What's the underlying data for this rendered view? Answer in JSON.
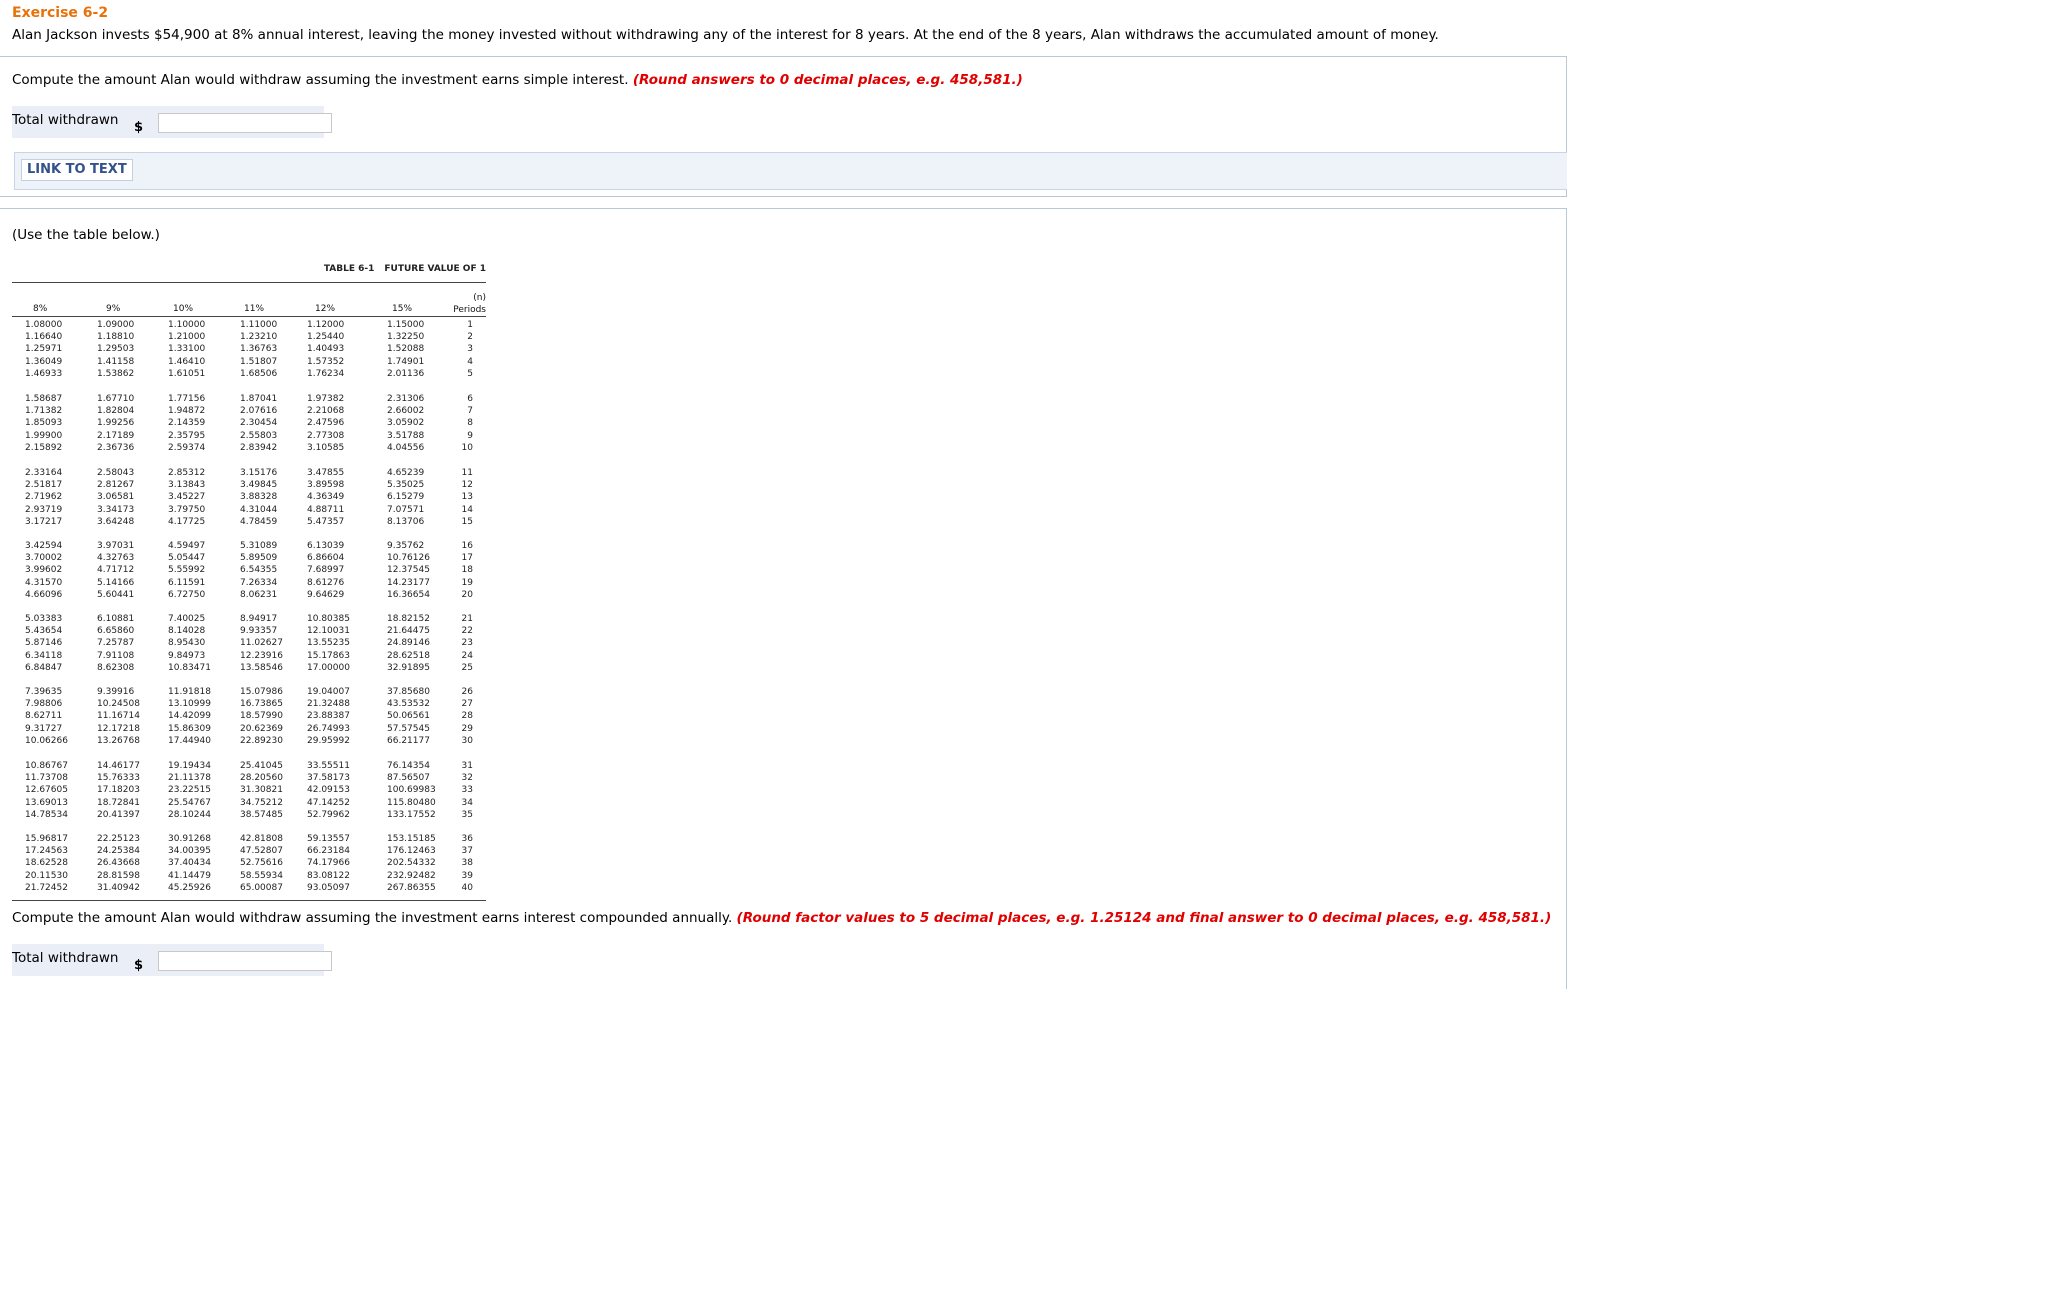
{
  "exercise_title": "Exercise 6-2",
  "problem_text": "Alan Jackson invests $54,900 at 8% annual interest, leaving the money invested without withdrawing any of the interest for 8 years. At the end of the 8 years, Alan withdraws the accumulated amount of money.",
  "q1": {
    "prompt": "Compute the amount Alan would withdraw assuming the investment earns simple interest.",
    "instruction": "(Round answers to 0 decimal places, e.g. 458,581.)",
    "answer_label": "Total withdrawn",
    "currency": "$",
    "value": ""
  },
  "link_button": "LINK TO TEXT",
  "use_table": "(Use the table below.)",
  "table": {
    "title_prefix": "TABLE 6-1",
    "title": "FUTURE VALUE OF 1",
    "headers": [
      "8%",
      "9%",
      "10%",
      "11%",
      "12%",
      "15%"
    ],
    "periods_header_top": "(n)",
    "periods_header": "Periods",
    "groups": [
      [
        [
          "1.08000",
          "1.09000",
          "1.10000",
          "1.11000",
          "1.12000",
          "1.15000",
          "1"
        ],
        [
          "1.16640",
          "1.18810",
          "1.21000",
          "1.23210",
          "1.25440",
          "1.32250",
          "2"
        ],
        [
          "1.25971",
          "1.29503",
          "1.33100",
          "1.36763",
          "1.40493",
          "1.52088",
          "3"
        ],
        [
          "1.36049",
          "1.41158",
          "1.46410",
          "1.51807",
          "1.57352",
          "1.74901",
          "4"
        ],
        [
          "1.46933",
          "1.53862",
          "1.61051",
          "1.68506",
          "1.76234",
          "2.01136",
          "5"
        ]
      ],
      [
        [
          "1.58687",
          "1.67710",
          "1.77156",
          "1.87041",
          "1.97382",
          "2.31306",
          "6"
        ],
        [
          "1.71382",
          "1.82804",
          "1.94872",
          "2.07616",
          "2.21068",
          "2.66002",
          "7"
        ],
        [
          "1.85093",
          "1.99256",
          "2.14359",
          "2.30454",
          "2.47596",
          "3.05902",
          "8"
        ],
        [
          "1.99900",
          "2.17189",
          "2.35795",
          "2.55803",
          "2.77308",
          "3.51788",
          "9"
        ],
        [
          "2.15892",
          "2.36736",
          "2.59374",
          "2.83942",
          "3.10585",
          "4.04556",
          "10"
        ]
      ],
      [
        [
          "2.33164",
          "2.58043",
          "2.85312",
          "3.15176",
          "3.47855",
          "4.65239",
          "11"
        ],
        [
          "2.51817",
          "2.81267",
          "3.13843",
          "3.49845",
          "3.89598",
          "5.35025",
          "12"
        ],
        [
          "2.71962",
          "3.06581",
          "3.45227",
          "3.88328",
          "4.36349",
          "6.15279",
          "13"
        ],
        [
          "2.93719",
          "3.34173",
          "3.79750",
          "4.31044",
          "4.88711",
          "7.07571",
          "14"
        ],
        [
          "3.17217",
          "3.64248",
          "4.17725",
          "4.78459",
          "5.47357",
          "8.13706",
          "15"
        ]
      ],
      [
        [
          "3.42594",
          "3.97031",
          "4.59497",
          "5.31089",
          "6.13039",
          "9.35762",
          "16"
        ],
        [
          "3.70002",
          "4.32763",
          "5.05447",
          "5.89509",
          "6.86604",
          "10.76126",
          "17"
        ],
        [
          "3.99602",
          "4.71712",
          "5.55992",
          "6.54355",
          "7.68997",
          "12.37545",
          "18"
        ],
        [
          "4.31570",
          "5.14166",
          "6.11591",
          "7.26334",
          "8.61276",
          "14.23177",
          "19"
        ],
        [
          "4.66096",
          "5.60441",
          "6.72750",
          "8.06231",
          "9.64629",
          "16.36654",
          "20"
        ]
      ],
      [
        [
          "5.03383",
          "6.10881",
          "7.40025",
          "8.94917",
          "10.80385",
          "18.82152",
          "21"
        ],
        [
          "5.43654",
          "6.65860",
          "8.14028",
          "9.93357",
          "12.10031",
          "21.64475",
          "22"
        ],
        [
          "5.87146",
          "7.25787",
          "8.95430",
          "11.02627",
          "13.55235",
          "24.89146",
          "23"
        ],
        [
          "6.34118",
          "7.91108",
          "9.84973",
          "12.23916",
          "15.17863",
          "28.62518",
          "24"
        ],
        [
          "6.84847",
          "8.62308",
          "10.83471",
          "13.58546",
          "17.00000",
          "32.91895",
          "25"
        ]
      ],
      [
        [
          "7.39635",
          "9.39916",
          "11.91818",
          "15.07986",
          "19.04007",
          "37.85680",
          "26"
        ],
        [
          "7.98806",
          "10.24508",
          "13.10999",
          "16.73865",
          "21.32488",
          "43.53532",
          "27"
        ],
        [
          "8.62711",
          "11.16714",
          "14.42099",
          "18.57990",
          "23.88387",
          "50.06561",
          "28"
        ],
        [
          "9.31727",
          "12.17218",
          "15.86309",
          "20.62369",
          "26.74993",
          "57.57545",
          "29"
        ],
        [
          "10.06266",
          "13.26768",
          "17.44940",
          "22.89230",
          "29.95992",
          "66.21177",
          "30"
        ]
      ],
      [
        [
          "10.86767",
          "14.46177",
          "19.19434",
          "25.41045",
          "33.55511",
          "76.14354",
          "31"
        ],
        [
          "11.73708",
          "15.76333",
          "21.11378",
          "28.20560",
          "37.58173",
          "87.56507",
          "32"
        ],
        [
          "12.67605",
          "17.18203",
          "23.22515",
          "31.30821",
          "42.09153",
          "100.69983",
          "33"
        ],
        [
          "13.69013",
          "18.72841",
          "25.54767",
          "34.75212",
          "47.14252",
          "115.80480",
          "34"
        ],
        [
          "14.78534",
          "20.41397",
          "28.10244",
          "38.57485",
          "52.79962",
          "133.17552",
          "35"
        ]
      ],
      [
        [
          "15.96817",
          "22.25123",
          "30.91268",
          "42.81808",
          "59.13557",
          "153.15185",
          "36"
        ],
        [
          "17.24563",
          "24.25384",
          "34.00395",
          "47.52807",
          "66.23184",
          "176.12463",
          "37"
        ],
        [
          "18.62528",
          "26.43668",
          "37.40434",
          "52.75616",
          "74.17966",
          "202.54332",
          "38"
        ],
        [
          "20.11530",
          "28.81598",
          "41.14479",
          "58.55934",
          "83.08122",
          "232.92482",
          "39"
        ],
        [
          "21.72452",
          "31.40942",
          "45.25926",
          "65.00087",
          "93.05097",
          "267.86355",
          "40"
        ]
      ]
    ]
  },
  "q2": {
    "prompt": "Compute the amount Alan would withdraw assuming the investment earns interest compounded annually.",
    "instruction": "(Round factor values to 5 decimal places, e.g. 1.25124 and final answer to 0 decimal places, e.g. 458,581.)",
    "answer_label": "Total withdrawn",
    "currency": "$",
    "value": ""
  }
}
